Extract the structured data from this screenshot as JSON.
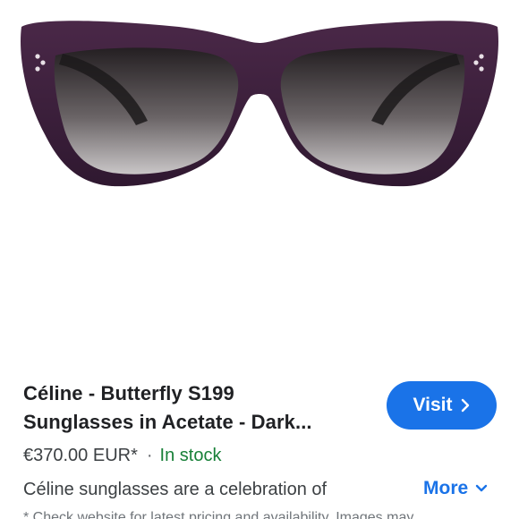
{
  "product": {
    "image_alt": "Dark purple butterfly sunglasses with gradient lenses",
    "frame_color": "#3b1f3a",
    "title_line1": "Céline - Butterfly S199",
    "title_line2": "Sunglasses in Acetate - Dark...",
    "price": "€370.00 EUR*",
    "separator": "·",
    "stock_status": "In stock",
    "description": "Céline sunglasses are a celebration of",
    "footnote": "* Check website for latest pricing and availability. Images may"
  },
  "actions": {
    "visit_label": "Visit",
    "more_label": "More"
  },
  "colors": {
    "accent": "#1a73e8",
    "in_stock": "#188038",
    "text_primary": "#202124",
    "text_secondary": "#3c4043"
  }
}
